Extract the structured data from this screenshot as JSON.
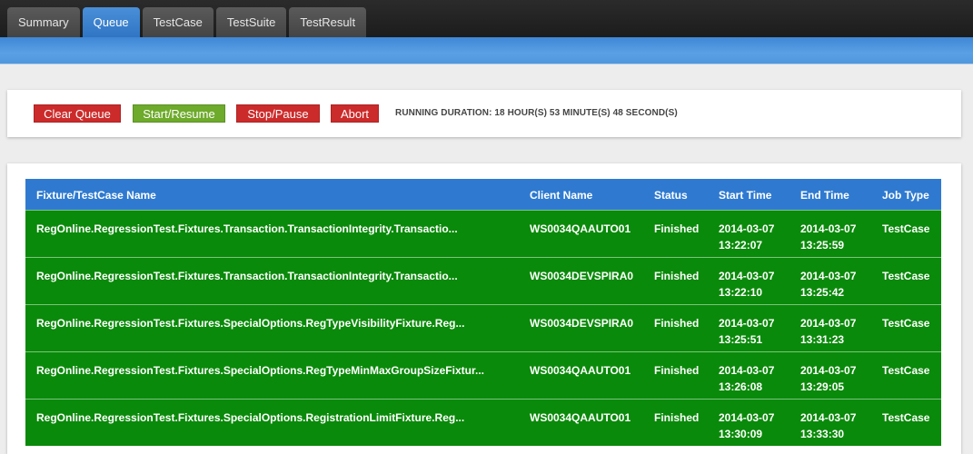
{
  "tabs": [
    {
      "label": "Summary",
      "active": false
    },
    {
      "label": "Queue",
      "active": true
    },
    {
      "label": "TestCase",
      "active": false
    },
    {
      "label": "TestSuite",
      "active": false
    },
    {
      "label": "TestResult",
      "active": false
    }
  ],
  "controls": {
    "clear_queue": "Clear Queue",
    "start_resume": "Start/Resume",
    "stop_pause": "Stop/Pause",
    "abort": "Abort",
    "duration": "RUNNING DURATION: 18 HOUR(S) 53 MINUTE(S) 48 SECOND(S)"
  },
  "table": {
    "headers": {
      "name": "Fixture/TestCase Name",
      "client": "Client Name",
      "status": "Status",
      "start": "Start Time",
      "end": "End Time",
      "job": "Job Type"
    },
    "rows": [
      {
        "name": "RegOnline.RegressionTest.Fixtures.Transaction.TransactionIntegrity.Transactio...",
        "client": "WS0034QAAUTO01",
        "status": "Finished",
        "start_date": "2014-03-07",
        "start_time": "13:22:07",
        "end_date": "2014-03-07",
        "end_time": "13:25:59",
        "job": "TestCase"
      },
      {
        "name": "RegOnline.RegressionTest.Fixtures.Transaction.TransactionIntegrity.Transactio...",
        "client": "WS0034DEVSPIRA0",
        "status": "Finished",
        "start_date": "2014-03-07",
        "start_time": "13:22:10",
        "end_date": "2014-03-07",
        "end_time": "13:25:42",
        "job": "TestCase"
      },
      {
        "name": "RegOnline.RegressionTest.Fixtures.SpecialOptions.RegTypeVisibilityFixture.Reg...",
        "client": "WS0034DEVSPIRA0",
        "status": "Finished",
        "start_date": "2014-03-07",
        "start_time": "13:25:51",
        "end_date": "2014-03-07",
        "end_time": "13:31:23",
        "job": "TestCase"
      },
      {
        "name": "RegOnline.RegressionTest.Fixtures.SpecialOptions.RegTypeMinMaxGroupSizeFixtur...",
        "client": "WS0034QAAUTO01",
        "status": "Finished",
        "start_date": "2014-03-07",
        "start_time": "13:26:08",
        "end_date": "2014-03-07",
        "end_time": "13:29:05",
        "job": "TestCase"
      },
      {
        "name": "RegOnline.RegressionTest.Fixtures.SpecialOptions.RegistrationLimitFixture.Reg...",
        "client": "WS0034QAAUTO01",
        "status": "Finished",
        "start_date": "2014-03-07",
        "start_time": "13:30:09",
        "end_date": "2014-03-07",
        "end_time": "13:33:30",
        "job": "TestCase"
      }
    ]
  },
  "colors": {
    "tab_active": "#2f75c4",
    "header_blue": "#2f7ad0",
    "row_green": "#0a8a0a",
    "button_red": "#cc2b2b",
    "button_green": "#6eaa2b"
  }
}
